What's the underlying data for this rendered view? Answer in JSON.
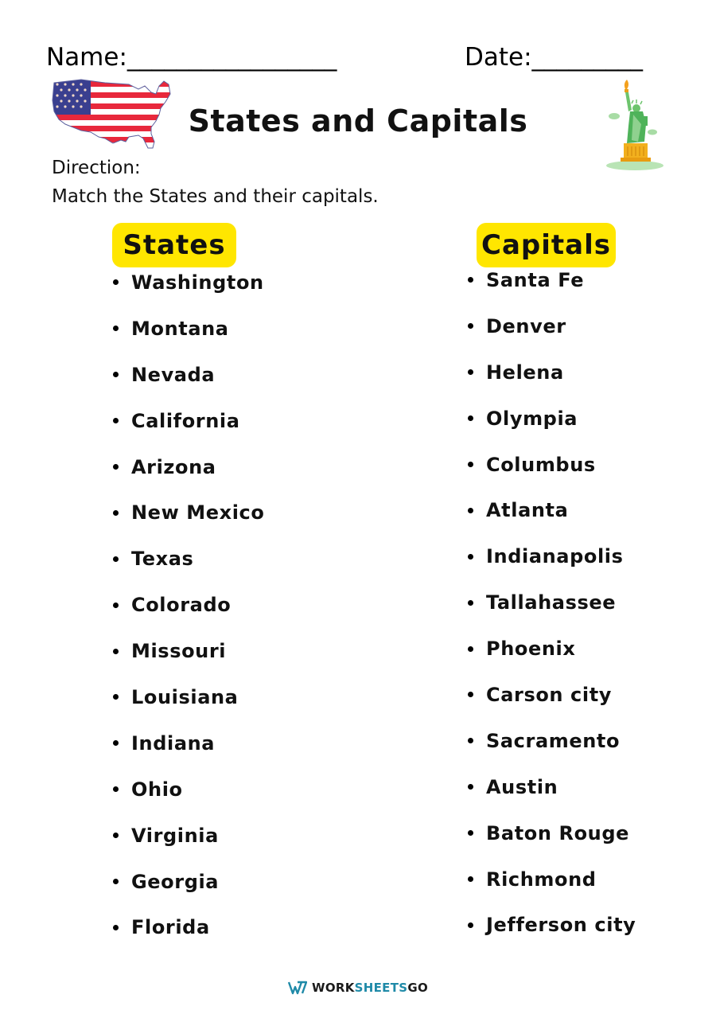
{
  "header": {
    "name_label": "Name:_________________",
    "date_label": "Date:_________"
  },
  "title": "States and Capitals",
  "direction": {
    "label": "Direction:",
    "text": "Match the States and their capitals."
  },
  "columns": {
    "states": {
      "heading": "States",
      "items": [
        "Washington",
        "Montana",
        "Nevada",
        "California",
        "Arizona",
        "New Mexico",
        "Texas",
        "Colorado",
        "Missouri",
        "Louisiana",
        "Indiana",
        "Ohio",
        "Virginia",
        "Georgia",
        "Florida"
      ]
    },
    "capitals": {
      "heading": "Capitals",
      "items": [
        "Santa Fe",
        "Denver",
        "Helena",
        "Olympia",
        "Columbus",
        "Atlanta",
        "Indianapolis",
        "Tallahassee",
        "Phoenix",
        "Carson city",
        "Sacramento",
        "Austin",
        "Baton Rouge",
        "Richmond",
        "Jefferson city"
      ]
    }
  },
  "icons": {
    "left": "usa-flag-map-icon",
    "right": "statue-of-liberty-icon",
    "footer": "worksheetsgo-logo-icon"
  },
  "colors": {
    "highlight": "#ffe600",
    "brand_teal": "#1f8aa8",
    "flag_red": "#e8283c",
    "flag_blue": "#3a3f8f"
  },
  "footer": {
    "brand_part1": "WORK",
    "brand_part2": "SHEETS",
    "brand_part3": "GO"
  }
}
